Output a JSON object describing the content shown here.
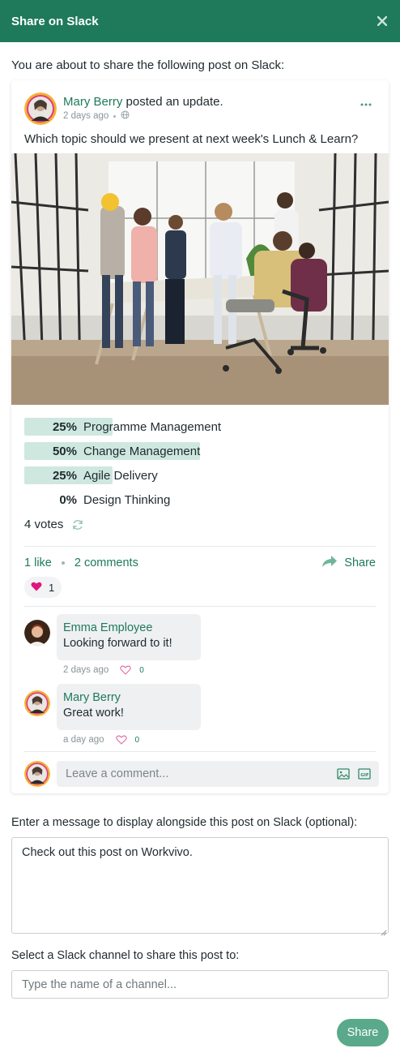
{
  "header": {
    "title": "Share on Slack",
    "close_icon": "close-icon"
  },
  "intro": "You are about to share the following post on Slack:",
  "post": {
    "author": "Mary Berry",
    "action": "posted an update.",
    "time": "2 days ago",
    "visibility_icon": "globe-icon",
    "question": "Which topic should we present at next week's Lunch & Learn?",
    "image_alt_icon": "photo-team-meeting",
    "poll": [
      {
        "percent": "25%",
        "value": 25,
        "label": "Programme Management"
      },
      {
        "percent": "50%",
        "value": 50,
        "label": "Change Management"
      },
      {
        "percent": "25%",
        "value": 25,
        "label": "Agile Delivery"
      },
      {
        "percent": "0%",
        "value": 0,
        "label": "Design Thinking"
      }
    ],
    "votes": "4 votes",
    "likes": "1 like",
    "comments_count": "2 comments",
    "share_label": "Share",
    "reaction_count": "1"
  },
  "comments": [
    {
      "author": "Emma Employee",
      "text": "Looking forward to it!",
      "time": "2 days ago",
      "likes": "0"
    },
    {
      "author": "Mary Berry",
      "text": "Great work!",
      "time": "a day ago",
      "likes": "0"
    }
  ],
  "comment_placeholder": "Leave a comment...",
  "message": {
    "label": "Enter a message to display alongside this post on Slack (optional):",
    "value": "Check out this post on Workvivo."
  },
  "channel": {
    "label": "Select a Slack channel to share this post to:",
    "placeholder": "Type the name of a channel..."
  },
  "submit_label": "Share",
  "colors": {
    "brand": "#1e7a5a",
    "poll_bar": "#cfe8df",
    "button": "#5aa98a",
    "heart": "#e0157f"
  }
}
